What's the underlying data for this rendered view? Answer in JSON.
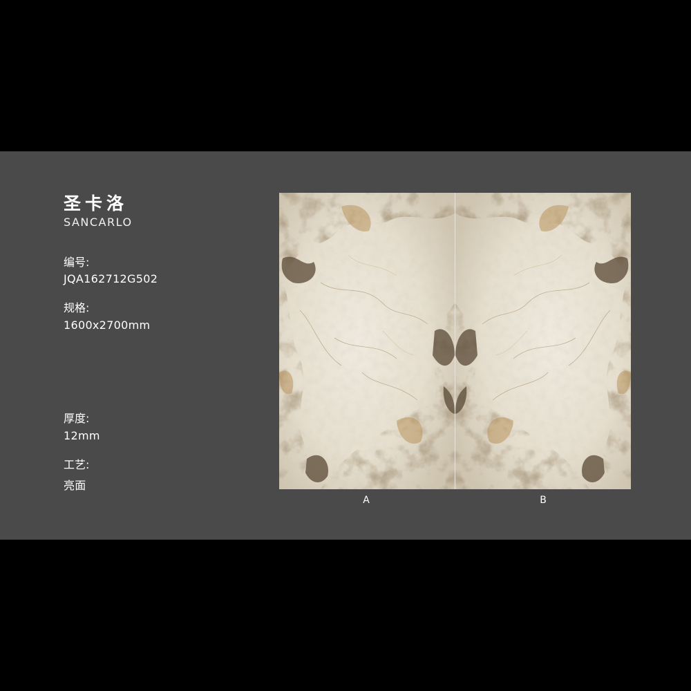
{
  "product": {
    "name_cn": "圣卡洛",
    "name_en": "SANCARLO"
  },
  "specs": {
    "code_label": "编号:",
    "code_value": "JQA162712G502",
    "size_label": "规格:",
    "size_value": "1600x2700mm",
    "thickness_label": "厚度:",
    "thickness_value": "12mm",
    "finish_label": "工艺:",
    "finish_value": "亮面"
  },
  "slabs": {
    "left_label": "A",
    "right_label": "B"
  },
  "colors": {
    "background": "#000000",
    "panel": "#4a4a4a",
    "marble_base": "#e8e2d4",
    "vein_brown": "#8a6a42",
    "vein_dark": "#4e4536",
    "vein_gold": "#c09a5e",
    "vein_grey": "#9e9a8e"
  }
}
